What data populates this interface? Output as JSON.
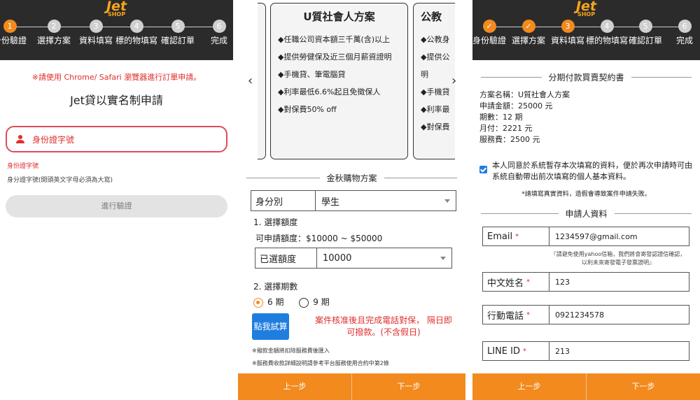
{
  "brand": {
    "logo_text": "Jet",
    "logo_sub": "SHOP"
  },
  "colors": {
    "accent": "#f28a1e",
    "error": "#e02d2d",
    "primary": "#1f7de0"
  },
  "panel1": {
    "steps": [
      {
        "num": "1",
        "label": "身份驗證",
        "state": "current"
      },
      {
        "num": "2",
        "label": "選擇方案",
        "state": "todo"
      },
      {
        "num": "3",
        "label": "資料填寫",
        "state": "todo"
      },
      {
        "num": "4",
        "label": "標的物填寫",
        "state": "todo"
      },
      {
        "num": "5",
        "label": "確認訂單",
        "state": "todo"
      },
      {
        "num": "6",
        "label": "完成",
        "state": "todo"
      }
    ],
    "browser_notice": "※請使用 Chrome/ Safari 瀏覽器進行訂單申請。",
    "title": "Jet貸以實名制申請",
    "id_placeholder": "身份證字號",
    "id_error": "身份證字號",
    "id_hint": "身分證字號(開頭英文字母必須為大寫)",
    "verify_button": "進行驗證"
  },
  "panel2": {
    "plan_card": {
      "title": "U質社會人方案",
      "bullets": [
        "◆任職公司資本額三千萬(含)以上",
        "◆提供勞健保及近三個月薪資證明",
        "◆手機貸、筆電腦貸",
        "◆利率最低6.6%起且免徵保人",
        "◆對保費50% off"
      ]
    },
    "next_card": {
      "title": "公教",
      "bullets": [
        "◆公教身",
        "◆提供公",
        "明",
        "◆手機貸",
        "◆利率最",
        "◆對保費"
      ]
    },
    "section_title": "金秋購物方案",
    "identity": {
      "label": "身分別",
      "value": "學生"
    },
    "amount_heading": "1. 選擇額度",
    "amount_range": "可申請額度：$10000 ~ $50000",
    "amount_select": {
      "label": "已選額度",
      "value": "10000"
    },
    "period_heading": "2. 選擇期數",
    "periods": [
      {
        "label": "6 期",
        "selected": true
      },
      {
        "label": "9 期",
        "selected": false
      }
    ],
    "try_button": "點我試算",
    "approval_msg": "案件核准後且完成電話對保， 隔日即可撥款。(不含假日)",
    "note1": "※撥款金額將扣除服務費後匯入",
    "note2": "※服務費收款詳細說明請參考平台服務使用合約中第2條",
    "prev_button": "上一步",
    "next_button": "下一步"
  },
  "panel3": {
    "steps": [
      {
        "num": "",
        "label": "身份驗證",
        "state": "done"
      },
      {
        "num": "",
        "label": "選擇方案",
        "state": "done"
      },
      {
        "num": "3",
        "label": "資料填寫",
        "state": "current"
      },
      {
        "num": "4",
        "label": "標的物填寫",
        "state": "todo"
      },
      {
        "num": "5",
        "label": "確認訂單",
        "state": "todo"
      },
      {
        "num": "6",
        "label": "完成",
        "state": "todo"
      }
    ],
    "contract_title": "分期付款買賣契約書",
    "contract_lines": [
      "方案名稱：U質社會人方案",
      "申請金額：25000 元",
      "期數：12 期",
      "月付：2221 元",
      "服務費：2500 元"
    ],
    "agree_text": "本人同意於系統暫存本次填寫的資料，便於再次申請時可由系統自動帶出前次填寫的個人基本資料。",
    "warning": "*請填寫真實資料，造假會導致案件申請失敗。",
    "applicant_title": "申請人資料",
    "email": {
      "label": "Email",
      "value": "1234597@gmail.com"
    },
    "email_note": "『請避免使用yahoo信箱，我們將會寄發認證信確認，以利未來寄發電子發票證明』",
    "name": {
      "label": "中文姓名",
      "value": "123"
    },
    "phone": {
      "label": "行動電話",
      "value": "0921234578"
    },
    "line": {
      "label": "LINE ID",
      "value": "213"
    },
    "required_mark": "*",
    "prev_button": "上一步",
    "next_button": "下一步"
  }
}
